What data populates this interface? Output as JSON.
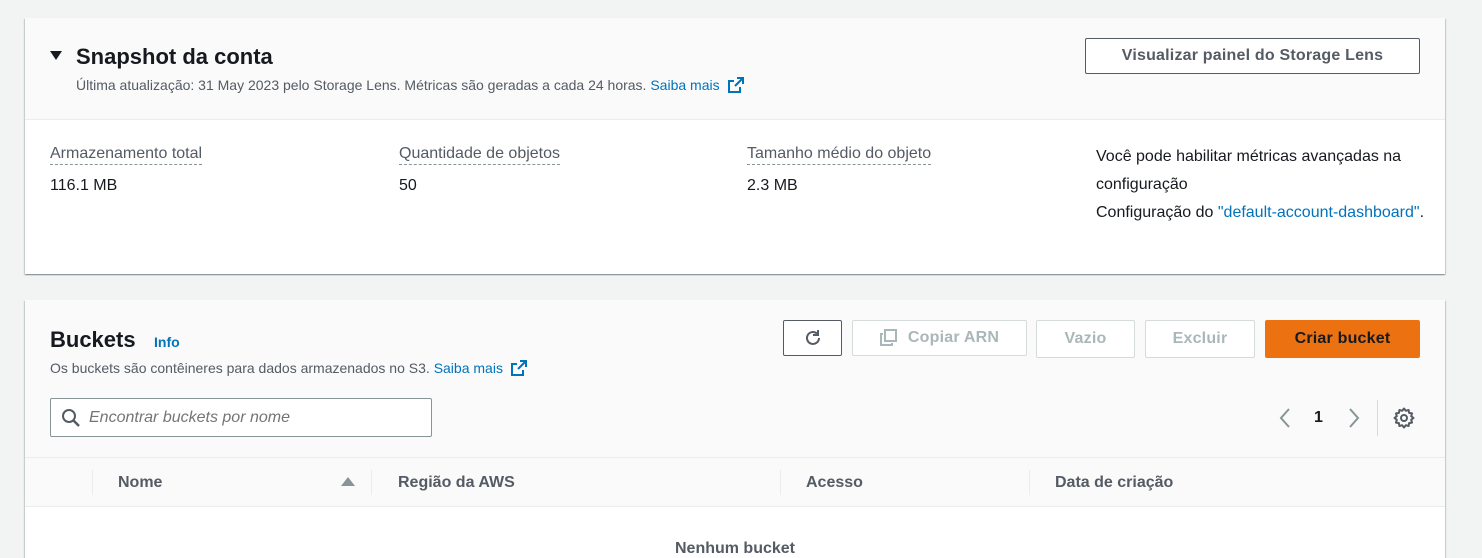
{
  "snapshot": {
    "title": "Snapshot da conta",
    "subtitle": "Última atualização: 31 May 2023 pelo Storage Lens. Métricas são geradas a cada 24 horas.",
    "learn_more": "Saiba mais",
    "view_dashboard_button": "Visualizar painel do Storage Lens",
    "metrics": [
      {
        "label": "Armazenamento total",
        "value": "116.1 MB"
      },
      {
        "label": "Quantidade de objetos",
        "value": "50"
      },
      {
        "label": "Tamanho médio do objeto",
        "value": "2.3 MB"
      }
    ],
    "advanced_text_line1": "Você pode habilitar métricas avançadas na configuração",
    "advanced_text_prefix": "Configuração do ",
    "advanced_link": "\"default-account-dashboard\"",
    "advanced_suffix": "."
  },
  "buckets": {
    "title": "Buckets",
    "info": "Info",
    "description": "Os buckets são contêineres para dados armazenados no S3.",
    "learn_more": "Saiba mais",
    "buttons": {
      "copy_arn": "Copiar ARN",
      "empty": "Vazio",
      "delete": "Excluir",
      "create": "Criar bucket"
    },
    "search_placeholder": "Encontrar buckets por nome",
    "page_number": "1",
    "columns": [
      "Nome",
      "Região da AWS",
      "Acesso",
      "Data de criação"
    ],
    "empty_message": "Nenhum bucket"
  },
  "colors": {
    "primary_orange": "#ec7211",
    "link_blue": "#0073bb",
    "text_dark": "#16191f",
    "text_muted": "#545b64"
  }
}
